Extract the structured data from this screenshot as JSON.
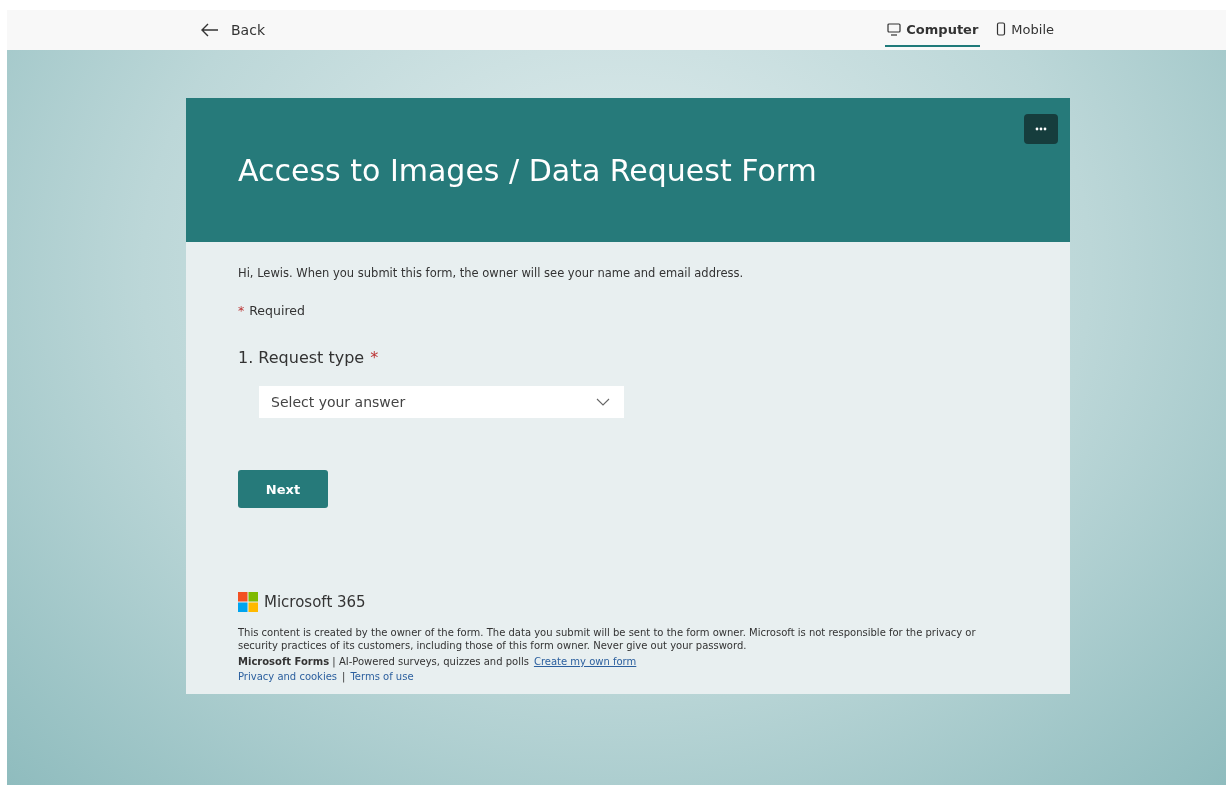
{
  "top_bar": {
    "back_label": "Back",
    "view_tabs": [
      {
        "label": "Computer",
        "kind": "computer",
        "selected": true
      },
      {
        "label": "Mobile",
        "kind": "mobile",
        "selected": false
      }
    ]
  },
  "form": {
    "title": "Access to Images / Data Request Form",
    "intro": "Hi, Lewis. When you submit this form, the owner will see your name and email address.",
    "required_legend": {
      "mark": "*",
      "text": "Required"
    },
    "questions": [
      {
        "number": "1.",
        "label": "Request type",
        "required": true,
        "placeholder": "Select your answer"
      }
    ],
    "next_button": "Next"
  },
  "footer": {
    "brand": "Microsoft 365",
    "disclaimer": "This content is created by the owner of the form. The data you submit will be sent to the form owner. Microsoft is not responsible for the privacy or security practices of its customers, including those of this form owner. Never give out your password.",
    "tagline": "**Microsoft Forms** | AI-Powered surveys, quizzes and polls",
    "create_link": "Create my own form",
    "links": [
      "Privacy and cookies",
      "Terms of use"
    ],
    "separator": "|"
  }
}
